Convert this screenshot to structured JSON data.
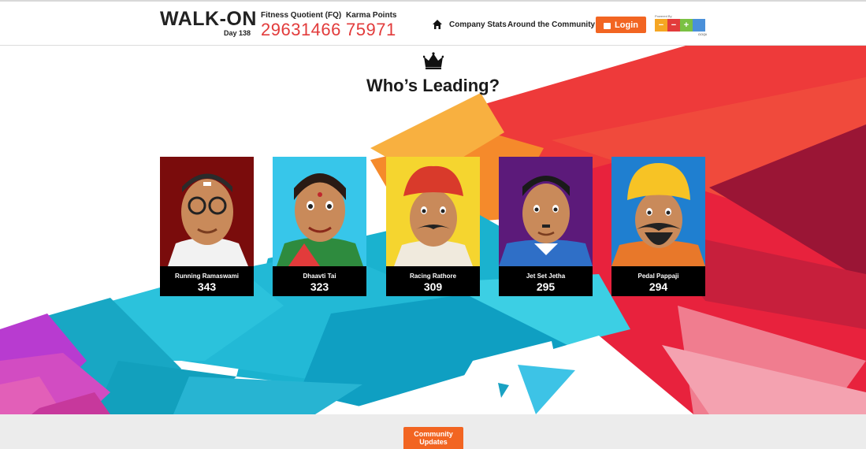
{
  "header": {
    "logo_text": "WALK-ON",
    "day_label": "Day 138",
    "fq_label": "Fitness Quotient (FQ)",
    "fq_value": "29631466",
    "karma_label": "Karma Points",
    "karma_value": "75971",
    "nav": [
      {
        "label": "Company Stats"
      },
      {
        "label": "Around the Community"
      }
    ],
    "login_label": "Login",
    "powered_by": "Powered By",
    "partner_name": "GOQii",
    "partner_glyphs": [
      "−",
      "−",
      "+",
      ""
    ]
  },
  "hero": {
    "title": "Who’s Leading?"
  },
  "leaders": [
    {
      "name": "Running Ramaswami",
      "score": "343",
      "bg": "#7a0c0c"
    },
    {
      "name": "Dhaavti Tai",
      "score": "323",
      "bg": "#37c6ea"
    },
    {
      "name": "Racing Rathore",
      "score": "309",
      "bg": "#f5d52f"
    },
    {
      "name": "Jet Set Jetha",
      "score": "295",
      "bg": "#5c1a7a"
    },
    {
      "name": "Pedal Pappaji",
      "score": "294",
      "bg": "#1f7fd0"
    }
  ],
  "footer": {
    "community_line1": "Community",
    "community_line2": "Updates"
  },
  "colors": {
    "accent": "#f26522",
    "stat_red": "#e23b3b"
  }
}
